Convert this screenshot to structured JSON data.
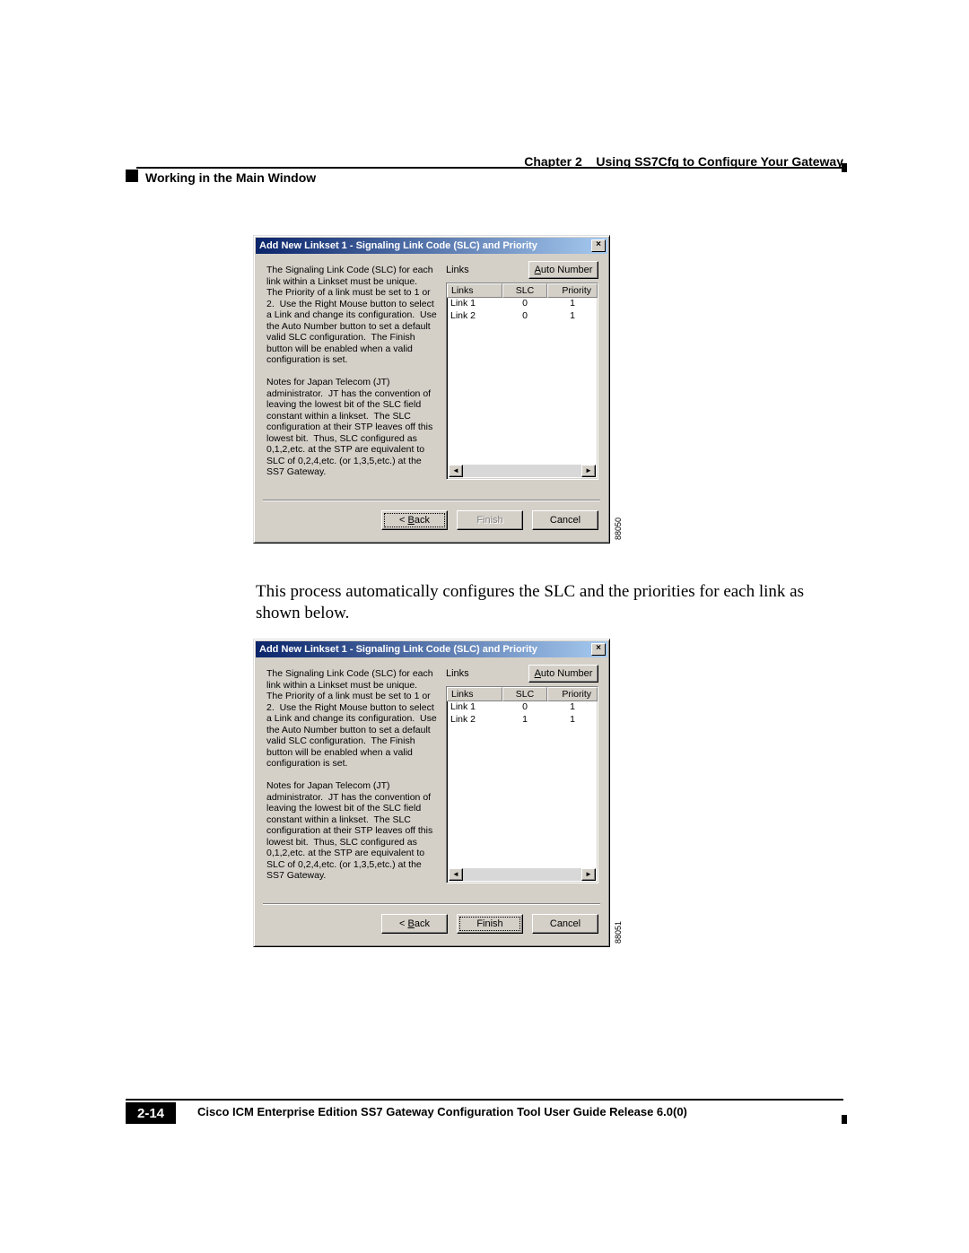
{
  "header": {
    "chapter_prefix": "Chapter 2",
    "chapter_title": "Using SS7Cfg to Configure Your Gateway",
    "section_title": "Working in the Main Window"
  },
  "body_text": "This process automatically configures the SLC and the priorities for each link as shown below.",
  "footer": {
    "doc_title": "Cisco ICM Enterprise Edition SS7 Gateway Configuration Tool User Guide Release 6.0(0)",
    "page_number": "2-14"
  },
  "dialog1": {
    "title": "Add New Linkset 1 - Signaling Link Code (SLC) and Priority",
    "close_x": "×",
    "description": "The Signaling Link Code (SLC) for each link within a Linkset must be unique.  The Priority of a link must be set to 1 or 2.  Use the Right Mouse button to select a Link and change its configuration.  Use the Auto Number button to set a default valid SLC configuration.  The Finish button will be enabled when a valid configuration is set.\n\nNotes for Japan Telecom (JT) administrator.  JT has the convention of leaving the lowest bit of the SLC field constant within a linkset.  The SLC configuration at their STP leaves off this lowest bit.  Thus, SLC configured as 0,1,2,etc. at the STP are equivalent to SLC of 0,2,4,etc. (or 1,3,5,etc.) at the SS7 Gateway.",
    "links_label": "Links",
    "auto_number_label": "Auto Number",
    "auto_number_u": "A",
    "columns": {
      "links": "Links",
      "slc": "SLC",
      "priority": "Priority"
    },
    "rows": [
      {
        "name": "Link 1",
        "slc": "0",
        "priority": "1"
      },
      {
        "name": "Link 2",
        "slc": "0",
        "priority": "1"
      }
    ],
    "buttons": {
      "back": "< Back",
      "back_u": "B",
      "finish": "Finish",
      "cancel": "Cancel"
    },
    "finish_enabled": false,
    "fig_id": "88050"
  },
  "dialog2": {
    "title": "Add New Linkset 1 - Signaling Link Code (SLC) and Priority",
    "close_x": "×",
    "description": "The Signaling Link Code (SLC) for each link within a Linkset must be unique.  The Priority of a link must be set to 1 or 2.  Use the Right Mouse button to select a Link and change its configuration.  Use the Auto Number button to set a default valid SLC configuration.  The Finish button will be enabled when a valid configuration is set.\n\nNotes for Japan Telecom (JT) administrator.  JT has the convention of leaving the lowest bit of the SLC field constant within a linkset.  The SLC configuration at their STP leaves off this lowest bit.  Thus, SLC configured as 0,1,2,etc. at the STP are equivalent to SLC of 0,2,4,etc. (or 1,3,5,etc.) at the SS7 Gateway.",
    "links_label": "Links",
    "auto_number_label": "Auto Number",
    "auto_number_u": "A",
    "columns": {
      "links": "Links",
      "slc": "SLC",
      "priority": "Priority"
    },
    "rows": [
      {
        "name": "Link 1",
        "slc": "0",
        "priority": "1"
      },
      {
        "name": "Link 2",
        "slc": "1",
        "priority": "1"
      }
    ],
    "buttons": {
      "back": "< Back",
      "back_u": "B",
      "finish": "Finish",
      "cancel": "Cancel"
    },
    "finish_enabled": true,
    "fig_id": "88051"
  }
}
